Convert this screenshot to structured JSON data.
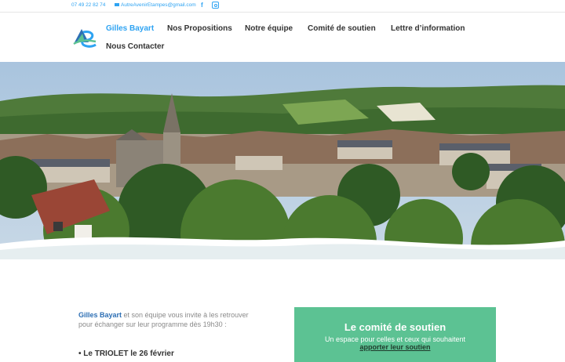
{
  "topbar": {
    "phone": "07 49 22 82 74",
    "email": "AutreAvenirEtampes@gmail.com",
    "social": [
      "facebook-icon",
      "instagram-icon"
    ]
  },
  "nav": {
    "items": [
      {
        "label": "Gilles Bayart",
        "active": true
      },
      {
        "label": "Nos Propositions"
      },
      {
        "label": "Notre équipe"
      },
      {
        "label": "Comité de soutien"
      },
      {
        "label": "Lettre d’information"
      },
      {
        "label": "Nous Contacter"
      }
    ]
  },
  "hero": {
    "image": "Town panorama with church and green hills"
  },
  "intro": {
    "name": "Gilles Bayart",
    "text": " et son équipe vous invite à les retrouver pour échanger sur leur programme dès 19h30 :",
    "next": "• Le TRIOLET le 26 février"
  },
  "card": {
    "title": "Le comité de soutien",
    "subtitle": "Un espace pour celles et ceux qui souhaitent",
    "link": "apporter leur soutien"
  },
  "colors": {
    "accent": "#2ea3f2",
    "green": "#5cc293",
    "name": "#2d6fb4"
  }
}
